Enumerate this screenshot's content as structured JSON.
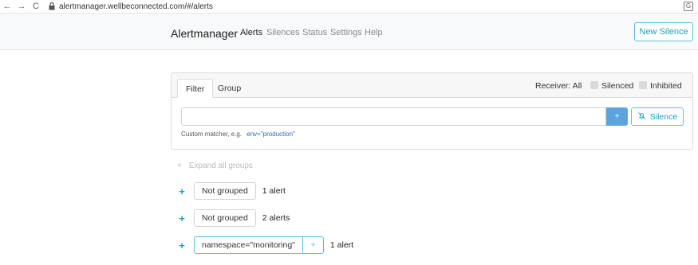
{
  "browser": {
    "back": "←",
    "forward": "→",
    "reload": "C",
    "url": "alertmanager.wellbeconnected.com/#/alerts",
    "translate": "G"
  },
  "navbar": {
    "brand": "Alertmanager",
    "links": [
      "Alerts",
      "Silences",
      "Status",
      "Settings",
      "Help"
    ],
    "new_silence": "New Silence"
  },
  "filter": {
    "tabs": [
      "Filter",
      "Group"
    ],
    "receiver": "Receiver: All",
    "silenced": "Silenced",
    "inhibited": "Inhibited",
    "input_value": "",
    "plus": "+",
    "silence": "Silence",
    "hint_prefix": "Custom matcher, e.g.",
    "hint_example": "env=\"production\""
  },
  "groups": {
    "expand_all": "Expand all groups",
    "items": [
      {
        "label": "Not grouped",
        "count": "1 alert"
      },
      {
        "label": "Not grouped",
        "count": "2 alerts"
      },
      {
        "label": "namespace=\"monitoring\"",
        "count": "1 alert",
        "plus": "+"
      }
    ]
  },
  "colors": {
    "accent": "#5bc0de",
    "plus_button": "#5ba4e0",
    "link": "#2a68c8"
  }
}
